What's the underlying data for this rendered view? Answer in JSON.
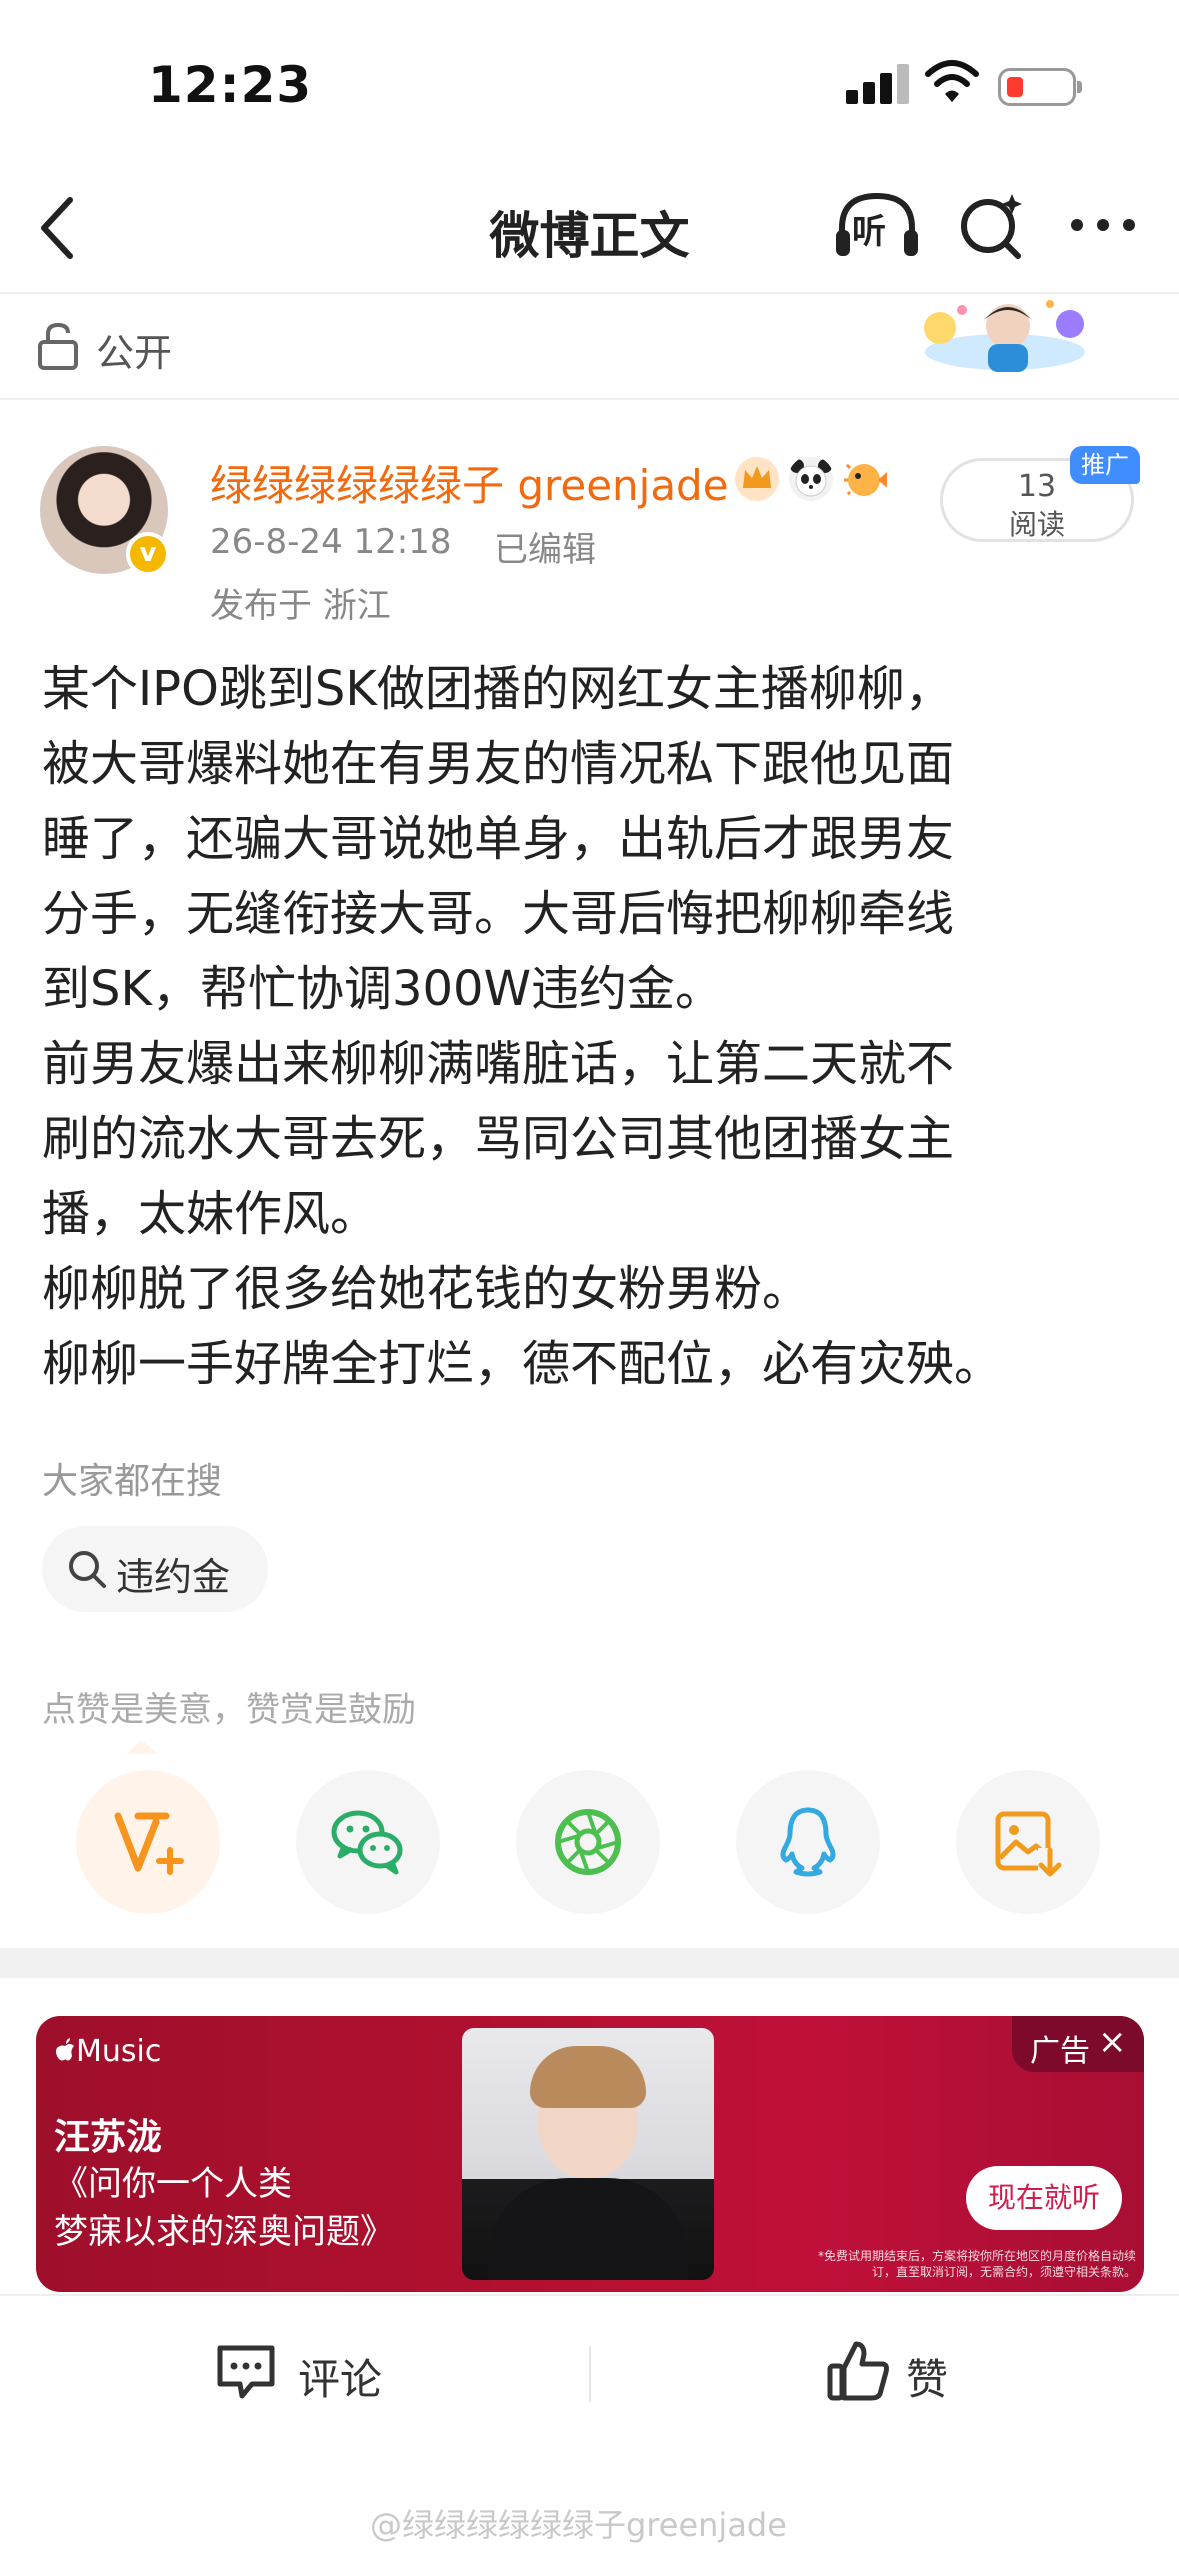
{
  "status_bar": {
    "time": "12:23"
  },
  "nav": {
    "title": "微博正文",
    "listen_label": "听"
  },
  "visibility": {
    "label": "公开"
  },
  "author": {
    "name": "绿绿绿绿绿绿子 greenjade",
    "verified_mark": "v",
    "timestamp": "26-8-24 12:18",
    "edited": "已编辑",
    "location": "发布于 浙江"
  },
  "reads": {
    "count": "13",
    "label": "阅读",
    "promo_badge": "推广"
  },
  "post": {
    "lines": [
      "某个IPO跳到SK做团播的网红女主播柳柳，",
      "被大哥爆料她在有男友的情况私下跟他见面",
      "睡了，还骗大哥说她单身，出轨后才跟男友",
      "分手，无缝衔接大哥。大哥后悔把柳柳牵线",
      "到SK，帮忙协调300W违约金。",
      "前男友爆出来柳柳满嘴脏话，让第二天就不",
      "刷的流水大哥去死，骂同公司其他团播女主",
      "播，太妹作风。",
      "柳柳脱了很多给她花钱的女粉男粉。",
      "柳柳一手好牌全打烂，德不配位，必有灾殃。"
    ]
  },
  "everyone_searching": {
    "heading": "大家都在搜",
    "chip_label": "违约金"
  },
  "like_note": "点赞是美意，赞赏是鼓励",
  "share_icons": [
    "reward-v-plus-icon",
    "wechat-icon",
    "moments-icon",
    "qq-icon",
    "save-image-icon"
  ],
  "ad": {
    "brand": "Music",
    "artist": "汪苏泷",
    "line1": "《问你一个人类",
    "line2": "梦寐以求的深奥问题》",
    "tag": "广告",
    "close": "×",
    "cta": "现在就听",
    "disclaimer": "*免费试用期结束后，方案将按你所在地区的月度价格自动续订，直至取消订阅，无需合约，须遵守相关条款。"
  },
  "bottom_bar": {
    "comment_label": "评论",
    "like_label": "赞"
  },
  "watermark": "@绿绿绿绿绿绿子greenjade",
  "colors": {
    "author_name": "#f26a0f",
    "promo_badge": "#3f8dff",
    "ad_background": "#b0102f",
    "reward_icon": "#f7941d",
    "wechat_icon": "#2aae67",
    "moments_icon": "#4cbf4f",
    "qq_icon": "#34a9e0",
    "save_icon": "#f29a1e"
  }
}
